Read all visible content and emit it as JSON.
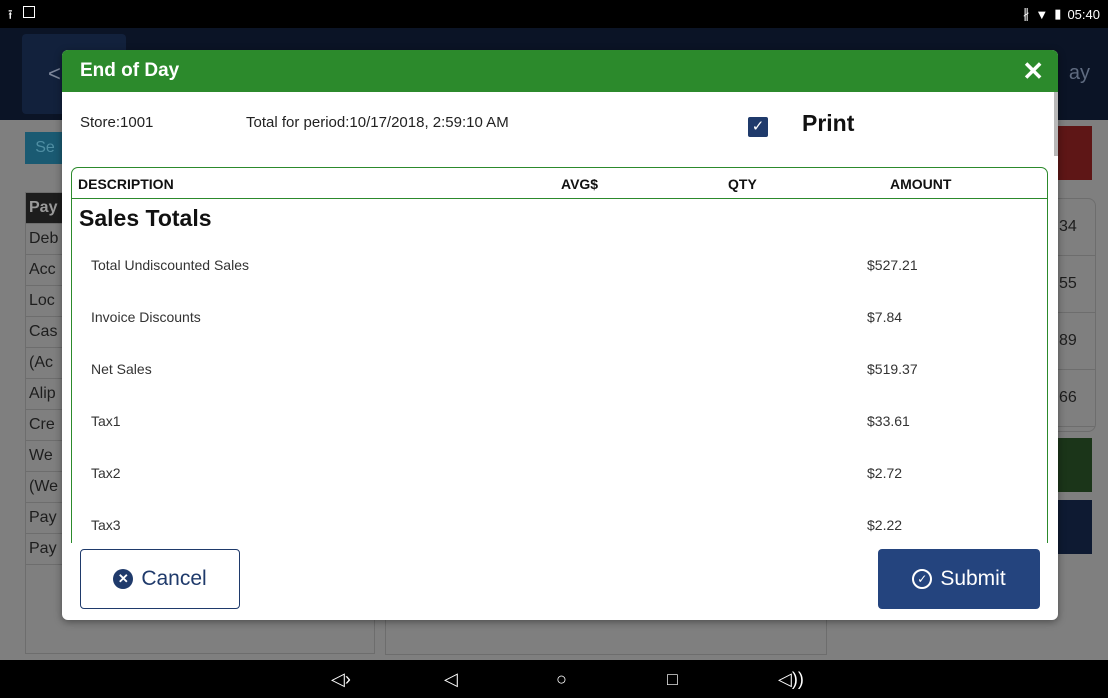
{
  "status_bar": {
    "time": "05:40",
    "left_icons": [
      "upload-icon",
      "image-icon"
    ],
    "right_icons": [
      "bluetooth-icon",
      "wifi-icon",
      "battery-icon"
    ]
  },
  "background": {
    "header_right_text": "ay",
    "select_button_label": "Se",
    "table_rows": [
      "Pay",
      "Deb",
      "Acc",
      "Loc",
      "Cas",
      "(Ac",
      "Alip",
      "Cre",
      "We",
      "(We",
      "Pay",
      "Pay"
    ],
    "right_values": [
      "34",
      "55",
      "89",
      "66"
    ]
  },
  "modal": {
    "title": "End of Day",
    "close_icon": "close-icon",
    "store_label": "Store:1001",
    "period_label": "Total for period:10/17/2018, 2:59:10 AM",
    "print_label": "Print",
    "print_checked": true,
    "columns": {
      "description": "DESCRIPTION",
      "avg": "AVG$",
      "qty": "QTY",
      "amount": "AMOUNT"
    },
    "section_title": "Sales Totals",
    "lines": [
      {
        "description": "Total Undiscounted Sales",
        "amount": "$527.21"
      },
      {
        "description": "Invoice Discounts",
        "amount": "$7.84"
      },
      {
        "description": "Net Sales",
        "amount": "$519.37"
      },
      {
        "description": "Tax1",
        "amount": "$33.61"
      },
      {
        "description": "Tax2",
        "amount": "$2.72"
      },
      {
        "description": "Tax3",
        "amount": "$2.22"
      }
    ],
    "cancel_label": "Cancel",
    "submit_label": "Submit"
  },
  "nav_bar": {
    "icons": [
      "volume-down-icon",
      "back-icon",
      "home-icon",
      "recents-icon",
      "volume-up-icon"
    ]
  },
  "colors": {
    "header_green": "#2c8a2c",
    "primary_navy": "#24447e"
  }
}
